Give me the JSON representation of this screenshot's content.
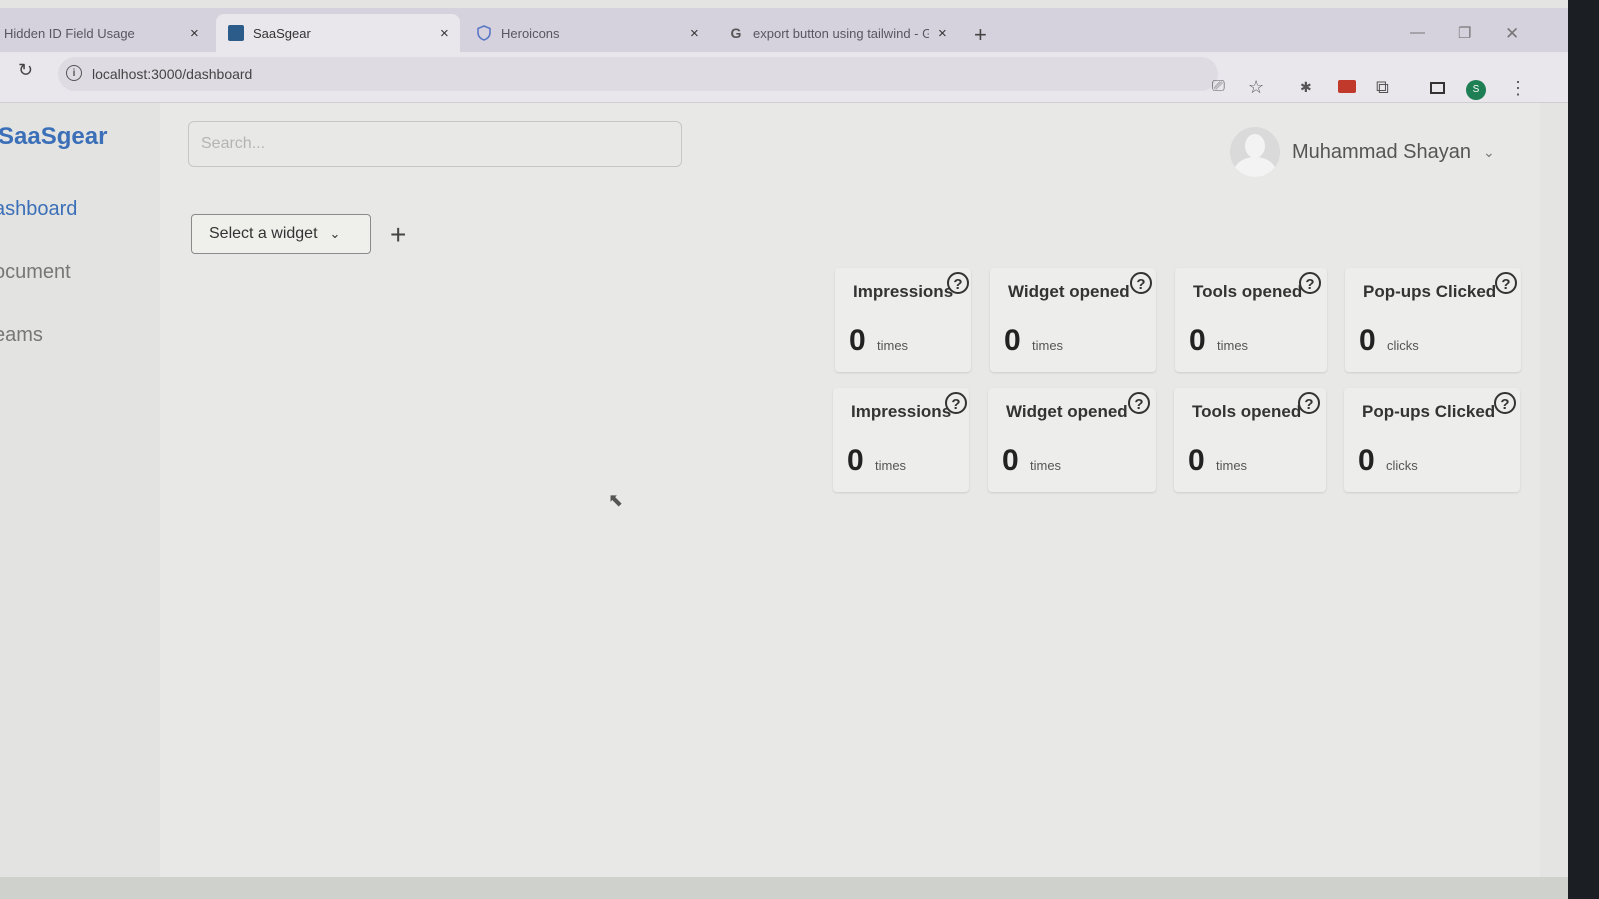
{
  "browser": {
    "tabs": [
      {
        "title": "Hidden ID Field Usage"
      },
      {
        "title": "SaaSgear"
      },
      {
        "title": "Heroicons"
      },
      {
        "title": "export button using tailwind - G"
      }
    ],
    "tab_close": "×",
    "new_tab": "+",
    "url": "localhost:3000/dashboard",
    "profile_initial": "S",
    "icons": [
      "reload-icon",
      "site-info-icon",
      "cast-icon",
      "bookmark-star-icon",
      "bug-extension-icon",
      "extension-icon",
      "puzzle-icon",
      "side-panel-icon",
      "profile-icon",
      "menu-icon"
    ]
  },
  "app": {
    "logo": "SaaSgear",
    "nav": [
      {
        "label": "ashboard",
        "active": true
      },
      {
        "label": "ocument",
        "active": false
      },
      {
        "label": "eams",
        "active": false
      }
    ],
    "search_placeholder": "Search...",
    "user_name": "Muhammad Shayan",
    "widget_select": "Select a widget",
    "add_widget": "+"
  },
  "stat_rows": [
    [
      {
        "title": "Impressions",
        "value": "0",
        "unit": "times"
      },
      {
        "title": "Widget opened",
        "value": "0",
        "unit": "times"
      },
      {
        "title": "Tools opened",
        "value": "0",
        "unit": "times"
      },
      {
        "title": "Pop-ups Clicked",
        "value": "0",
        "unit": "clicks"
      }
    ],
    [
      {
        "title": "Impressions",
        "value": "0",
        "unit": "times"
      },
      {
        "title": "Widget opened",
        "value": "0",
        "unit": "times"
      },
      {
        "title": "Tools opened",
        "value": "0",
        "unit": "times"
      },
      {
        "title": "Pop-ups Clicked",
        "value": "0",
        "unit": "clicks"
      }
    ]
  ],
  "help_glyph": "?",
  "colors": {
    "brand": "#3b6fb8",
    "page_bg": "#e8e9e6"
  }
}
